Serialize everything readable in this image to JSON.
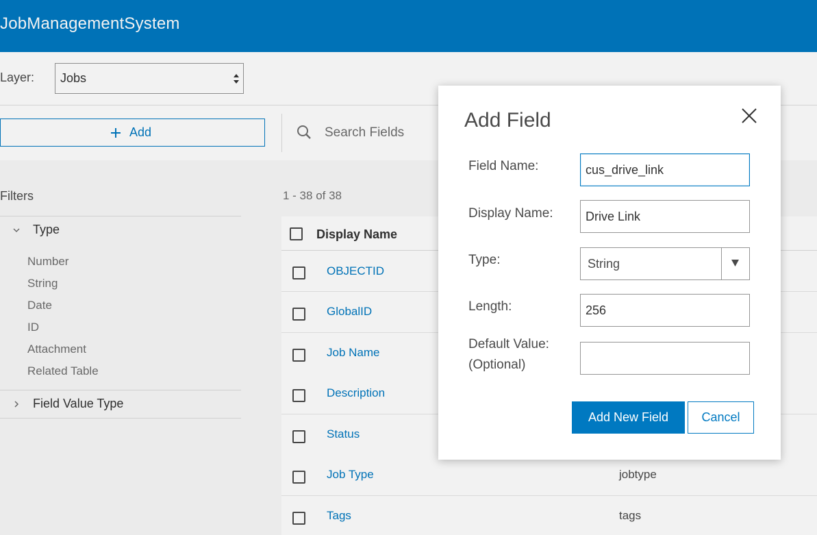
{
  "header": {
    "title": "JobManagementSystem"
  },
  "layer": {
    "label": "Layer:",
    "selected": "Jobs"
  },
  "toolbar": {
    "add_label": "Add",
    "search_placeholder": "Search Fields"
  },
  "filters": {
    "title": "Filters",
    "type_group": "Type",
    "type_items": [
      "Number",
      "String",
      "Date",
      "ID",
      "Attachment",
      "Related Table"
    ],
    "field_value_group": "Field Value Type"
  },
  "table": {
    "count": "1 - 38 of 38",
    "column_display_name": "Display Name",
    "rows": [
      {
        "display": "OBJECTID",
        "field": ""
      },
      {
        "display": "GlobalID",
        "field": ""
      },
      {
        "display": "Job Name",
        "field": ""
      },
      {
        "display": "Description",
        "field": ""
      },
      {
        "display": "Status",
        "field": ""
      },
      {
        "display": "Job Type",
        "field": "jobtype"
      },
      {
        "display": "Tags",
        "field": "tags"
      }
    ]
  },
  "modal": {
    "title": "Add Field",
    "field_name_label": "Field Name:",
    "field_name_value": "cus_drive_link",
    "display_name_label": "Display Name:",
    "display_name_value": "Drive Link",
    "type_label": "Type:",
    "type_value": "String",
    "length_label": "Length:",
    "length_value": "256",
    "default_label_line1": "Default Value:",
    "default_label_line2": "(Optional)",
    "default_value": "",
    "add_button": "Add New Field",
    "cancel_button": "Cancel"
  },
  "colors": {
    "brand": "#0079c1",
    "text": "#323232",
    "muted": "#6e6e6e"
  }
}
